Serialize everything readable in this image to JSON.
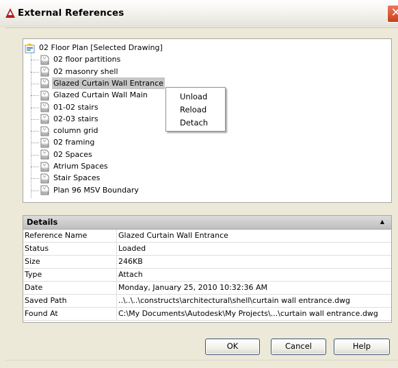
{
  "window": {
    "title": "External References",
    "close_glyph": "✕"
  },
  "tree": {
    "root_label": "02 Floor Plan [Selected Drawing]",
    "items": [
      {
        "label": "02 floor partitions",
        "selected": false
      },
      {
        "label": "02 masonry shell",
        "selected": false
      },
      {
        "label": "Glazed Curtain Wall Entrance",
        "selected": true
      },
      {
        "label": "Glazed Curtain Wall Main",
        "selected": false
      },
      {
        "label": "01-02 stairs",
        "selected": false
      },
      {
        "label": "02-03 stairs",
        "selected": false
      },
      {
        "label": "column grid",
        "selected": false
      },
      {
        "label": "02 framing",
        "selected": false
      },
      {
        "label": "02 Spaces",
        "selected": false
      },
      {
        "label": "Atrium Spaces",
        "selected": false
      },
      {
        "label": "Stair Spaces",
        "selected": false
      },
      {
        "label": "Plan 96 MSV Boundary",
        "selected": false
      }
    ]
  },
  "context_menu": {
    "items": [
      "Unload",
      "Reload",
      "Detach"
    ]
  },
  "details": {
    "title": "Details",
    "rows": [
      {
        "key": "Reference Name",
        "value": "Glazed Curtain Wall Entrance"
      },
      {
        "key": "Status",
        "value": "Loaded"
      },
      {
        "key": "Size",
        "value": "246KB"
      },
      {
        "key": "Type",
        "value": "Attach"
      },
      {
        "key": "Date",
        "value": "Monday, January 25, 2010  10:32:36 AM"
      },
      {
        "key": "Saved Path",
        "value": "..\\..\\..\\constructs\\architectural\\shell\\curtain wall entrance.dwg"
      },
      {
        "key": "Found At",
        "value": "C:\\My Documents\\Autodesk\\My Projects\\...\\curtain wall entrance.dwg"
      }
    ]
  },
  "buttons": {
    "ok": "OK",
    "cancel": "Cancel",
    "help": "Help"
  },
  "icons": {
    "app": "autocad-app-icon",
    "root": "drawing-root-icon",
    "item": "dwg-file-icon"
  }
}
